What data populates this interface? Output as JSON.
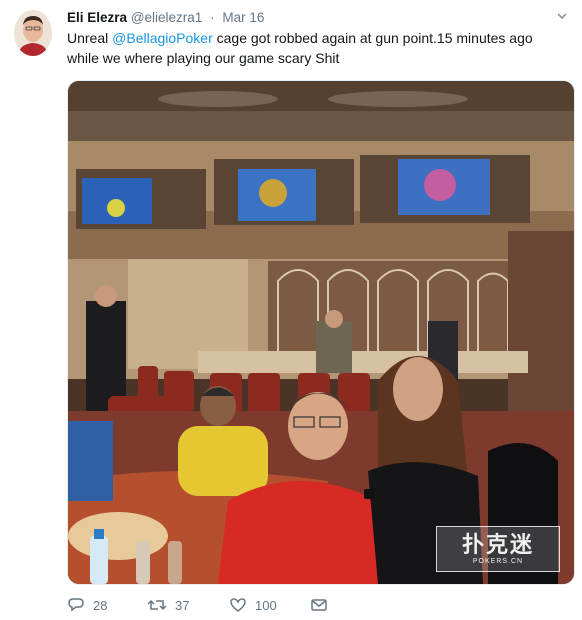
{
  "tweet": {
    "author_name": "Eli Elezra",
    "author_handle": "@elielezra1",
    "separator": "·",
    "date": "Mar 16",
    "text_before": "Unreal ",
    "mention": "@BellagioPoker",
    "text_after": " cage got robbed again at gun point.15 minutes ago while we where playing our game scary Shit"
  },
  "actions": {
    "reply_count": "28",
    "retweet_count": "37",
    "like_count": "100"
  },
  "watermark": {
    "main": "扑克迷",
    "sub": "POKERS.CN"
  },
  "colors": {
    "link": "#1b95e0",
    "muted": "#657786",
    "text": "#14171a"
  },
  "icons": [
    "avatar",
    "caret-down-icon",
    "reply-icon",
    "retweet-icon",
    "like-icon",
    "message-icon"
  ]
}
